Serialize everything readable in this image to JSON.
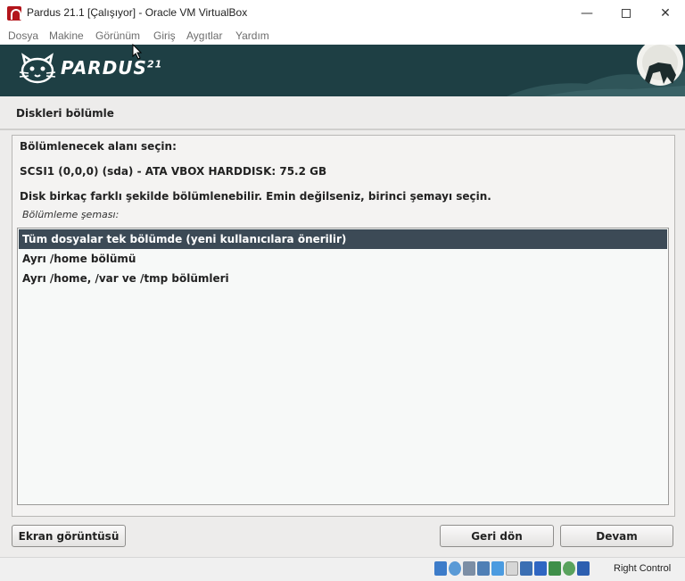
{
  "window": {
    "title": "Pardus 21.1 [Çalışıyor] - Oracle VM VirtualBox",
    "controls": {
      "minimize": "—",
      "close": "✕"
    }
  },
  "menu": [
    "Dosya",
    "Makine",
    "Görünüm",
    "Giriş",
    "Aygıtlar",
    "Yardım"
  ],
  "banner": {
    "wordmark": "PARDUS",
    "version": "21"
  },
  "installer": {
    "page_title": "Diskleri bölümle",
    "select_label": "Bölümlenecek alanı seçin:",
    "disk": "SCSI1 (0,0,0) (sda) - ATA VBOX HARDDISK: 75.2 GB",
    "hint": "Disk birkaç farklı şekilde bölümlenebilir. Emin değilseniz, birinci şemayı seçin.",
    "list_label": "Bölümleme şeması:",
    "options": [
      {
        "label": "Tüm dosyalar tek bölümde (yeni kullanıcılara önerilir)",
        "selected": true
      },
      {
        "label": "Ayrı /home bölümü",
        "selected": false
      },
      {
        "label": "Ayrı /home, /var ve /tmp bölümleri",
        "selected": false
      }
    ],
    "buttons": {
      "screenshot": "Ekran görüntüsü",
      "back": "Geri dön",
      "continue": "Devam"
    }
  },
  "status": {
    "host_key": "Right Control",
    "icons": [
      "hard-disk-icon",
      "optical-drive-icon",
      "audio-icon",
      "network-icon",
      "usb-icon",
      "shared-folders-icon",
      "display-icon",
      "video-capture-icon",
      "cpu-icon",
      "mouse-integration-icon",
      "keyboard-icon"
    ]
  },
  "colors": {
    "banner_bg": "#1e3f44",
    "selection_bg": "#3c4a56",
    "installer_bg": "#edeceb"
  }
}
